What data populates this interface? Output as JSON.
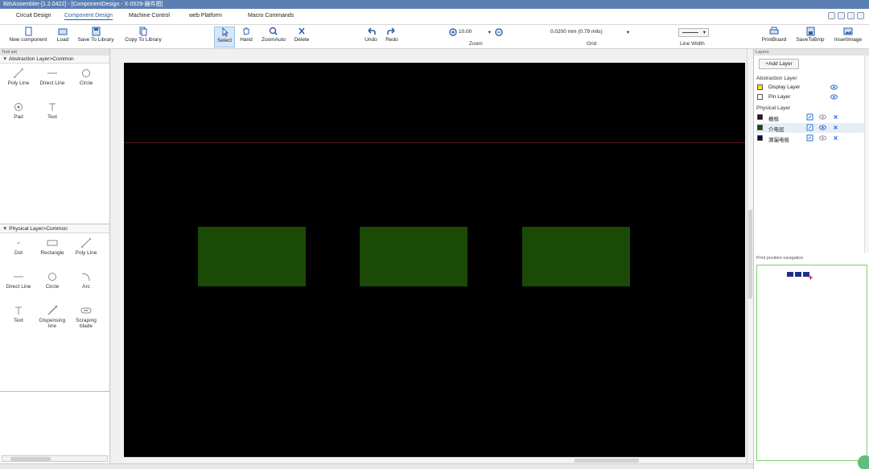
{
  "window": {
    "title": "BitsAssembler-[1.2.0422] - [ComponentDesign - X-0529-器件图]"
  },
  "menu": {
    "tabs": [
      {
        "label": "Circuit Design"
      },
      {
        "label": "Component Design"
      },
      {
        "label": "Machine Control"
      },
      {
        "label": "web Platform"
      },
      {
        "label": "Macro Commands"
      }
    ]
  },
  "toolbar": {
    "new_component": "New component",
    "load": "Load",
    "save_to_library": "Save To Library",
    "copy_to_library": "Copy To Library",
    "select": "Select",
    "hand": "Hand",
    "zoom_auto": "ZoomAuto",
    "delete": "Delete",
    "undo": "Undo",
    "redo": "Redo",
    "zoom_value": "10.00",
    "zoom_label": "Zoom",
    "grid_value": "0.0200 mm (0.79 mils)",
    "grid_label": "Grid",
    "line_width_label": "Line Width",
    "print_board": "PrintBoard",
    "save_to_bmp": "SaveToBmp",
    "insert_image": "InsertImage"
  },
  "left_panel": {
    "title": "Tool set",
    "abstraction": {
      "header": "Abstraction Layer>Common",
      "tools": [
        {
          "label": "Poly Line",
          "icon": "polyline-icon"
        },
        {
          "label": "Direct Line",
          "icon": "direct-line-icon"
        },
        {
          "label": "Circle",
          "icon": "circle-icon"
        },
        {
          "label": "Pad",
          "icon": "pad-icon"
        },
        {
          "label": "Text",
          "icon": "text-icon"
        }
      ]
    },
    "physical": {
      "header": "Physical Layer>Common",
      "tools": [
        {
          "label": "Dot",
          "icon": "dot-icon"
        },
        {
          "label": "Rectangle",
          "icon": "rectangle-icon"
        },
        {
          "label": "Poly Line",
          "icon": "polyline-icon"
        },
        {
          "label": "Direct Line",
          "icon": "direct-line-icon"
        },
        {
          "label": "Circle",
          "icon": "circle-icon"
        },
        {
          "label": "Arc",
          "icon": "arc-icon"
        },
        {
          "label": "Text",
          "icon": "text-icon"
        },
        {
          "label": "Dispensing line",
          "icon": "dispensing-line-icon"
        },
        {
          "label": "Scraping blade",
          "icon": "scraping-blade-icon"
        }
      ]
    }
  },
  "canvas": {
    "background": "#000000",
    "pad_color": "#1b4a07",
    "reference_line_color": "#5a1a1a"
  },
  "right_panel": {
    "title": "Layers",
    "add_layer": "+Add Layer",
    "abstraction_header": "Abstraction Layer",
    "abstraction_layers": [
      {
        "name": "Display Layer",
        "color": "#f5e21a"
      },
      {
        "name": "Pin Layer",
        "color": "#ffffff"
      }
    ],
    "physical_header": "Physical Layer",
    "physical_layers": [
      {
        "name": "栅极",
        "color": "#3a0a2a"
      },
      {
        "name": "介电层",
        "color": "#1b4a07"
      },
      {
        "name": "源漏电极",
        "color": "#0a0a3a"
      }
    ],
    "nav_title": "Print position navigation"
  }
}
